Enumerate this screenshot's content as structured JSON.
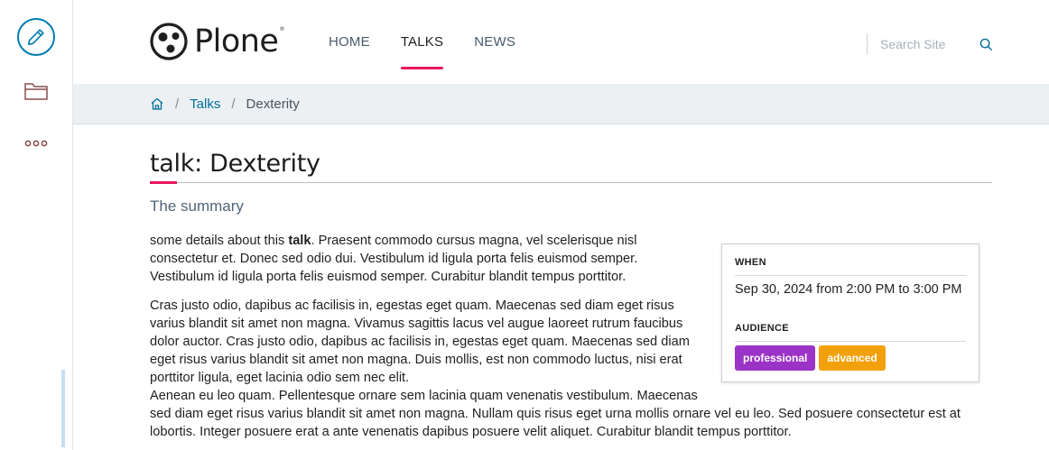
{
  "toolbar": {
    "edit_icon": "pencil-icon",
    "contents_icon": "folder-icon",
    "more_icon": "more-dots-icon"
  },
  "header": {
    "logo_text": "Plone",
    "logo_mark": "®",
    "nav": [
      {
        "label": "HOME",
        "active": false
      },
      {
        "label": "TALKS",
        "active": true
      },
      {
        "label": "NEWS",
        "active": false
      }
    ],
    "search_placeholder": "Search Site",
    "accent_color": "#e8175d"
  },
  "breadcrumbs": {
    "home_icon": "home-icon",
    "items": [
      {
        "label": "Talks",
        "link": true
      },
      {
        "label": "Dexterity",
        "link": false
      }
    ]
  },
  "page": {
    "title": "talk: Dexterity",
    "summary": "The summary",
    "p1_before": "some details about this ",
    "p1_bold": "talk",
    "p1_after": ". Praesent commodo cursus magna, vel scelerisque nisl consectetur et. Donec sed odio dui. Vestibulum id ligula porta felis euismod semper. Vestibulum id ligula porta felis euismod semper. Curabitur blandit tempus porttitor.",
    "p2": "Cras justo odio, dapibus ac facilisis in, egestas eget quam. Maecenas sed diam eget risus varius blandit sit amet non magna. Vivamus sagittis lacus vel augue laoreet rutrum faucibus dolor auctor. Cras justo odio, dapibus ac facilisis in, egestas eget quam. Maecenas sed diam eget risus varius blandit sit amet non magna. Duis mollis, est non commodo luctus, nisi erat porttitor ligula, eget lacinia odio sem nec elit.",
    "p3": "Aenean eu leo quam. Pellentesque ornare sem lacinia quam venenatis vestibulum. Maecenas sed diam eget risus varius blandit sit amet non magna. Nullam quis risus eget urna mollis ornare vel eu leo. Sed posuere consectetur est at lobortis. Integer posuere erat a ante venenatis dapibus posuere velit aliquet. Curabitur blandit tempus porttitor."
  },
  "event": {
    "when_label": "WHEN",
    "when_value": "Sep 30, 2024 from 2:00 PM to 3:00 PM",
    "audience_label": "AUDIENCE",
    "tags": [
      {
        "label": "professional",
        "color": "#9b34c6"
      },
      {
        "label": "advanced",
        "color": "#f2a10a"
      }
    ]
  }
}
